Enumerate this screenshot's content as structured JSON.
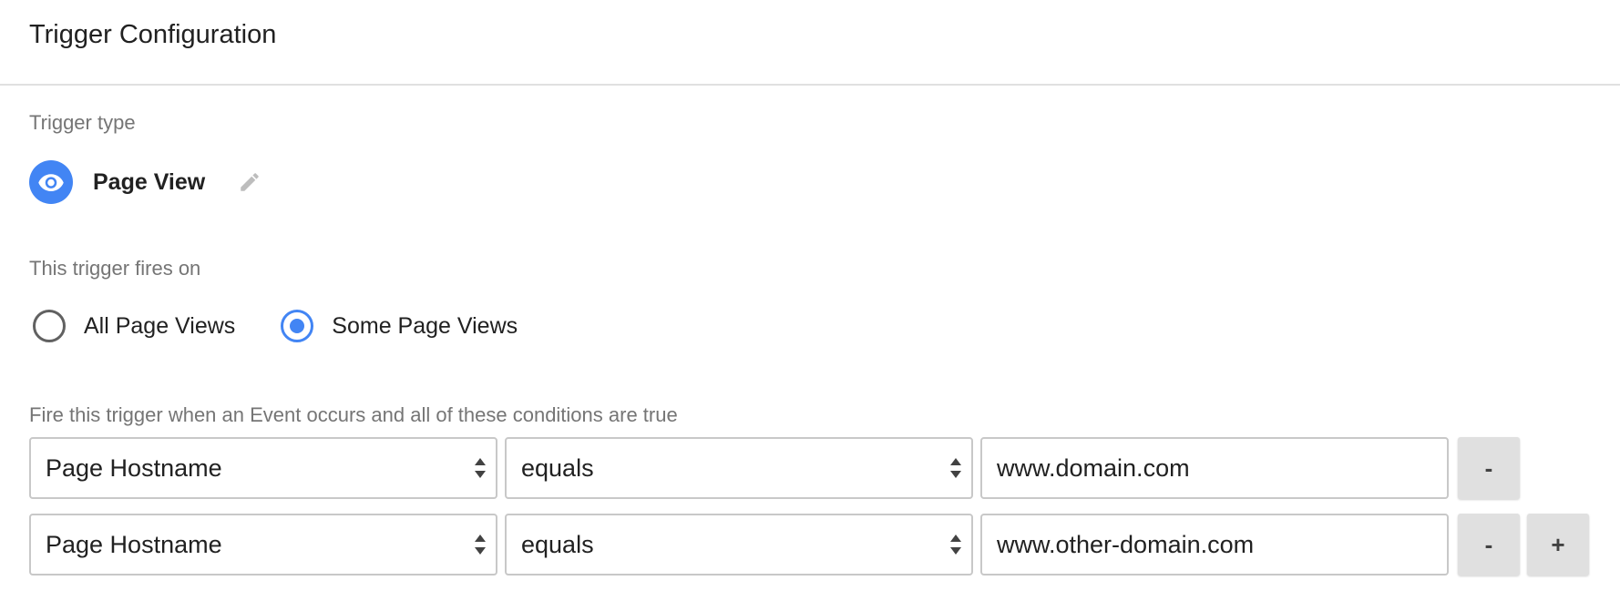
{
  "header": {
    "title": "Trigger Configuration"
  },
  "trigger_type": {
    "label": "Trigger type",
    "name": "Page View",
    "icon": "eye-icon",
    "accent": "#4285f4"
  },
  "fires_on": {
    "label": "This trigger fires on",
    "options": [
      {
        "label": "All Page Views",
        "checked": false
      },
      {
        "label": "Some Page Views",
        "checked": true
      }
    ]
  },
  "conditions": {
    "label": "Fire this trigger when an Event occurs and all of these conditions are true",
    "rows": [
      {
        "variable": "Page Hostname",
        "operator": "equals",
        "value": "www.domain.com",
        "remove_label": "-"
      },
      {
        "variable": "Page Hostname",
        "operator": "equals",
        "value": "www.other-domain.com",
        "remove_label": "-",
        "add_label": "+"
      }
    ]
  }
}
